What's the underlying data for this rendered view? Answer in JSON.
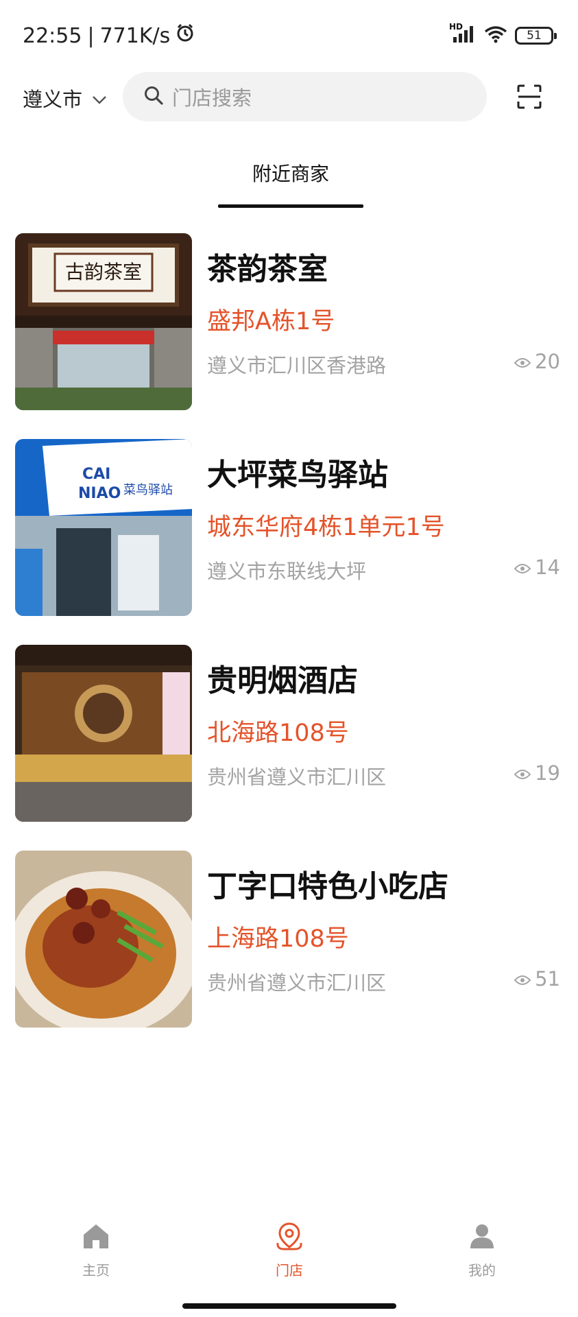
{
  "status_bar": {
    "time": "22:55",
    "speed": "771K/s",
    "battery": "51",
    "network": "HD"
  },
  "header": {
    "city": "遵义市",
    "search_placeholder": "门店搜索"
  },
  "tabs": [
    {
      "label": "附近商家",
      "active": true
    }
  ],
  "stores": [
    {
      "name": "茶韵茶室",
      "address": "盛邦A栋1号",
      "region": "遵义市汇川区香港路",
      "views": "20"
    },
    {
      "name": "大坪菜鸟驿站",
      "address": "城东华府4栋1单元1号",
      "region": "遵义市东联线大坪",
      "views": "14"
    },
    {
      "name": "贵明烟酒店",
      "address": "北海路108号",
      "region": "贵州省遵义市汇川区",
      "views": "19"
    },
    {
      "name": "丁字口特色小吃店",
      "address": "上海路108号",
      "region": "贵州省遵义市汇川区",
      "views": "51"
    }
  ],
  "bottom_nav": [
    {
      "label": "主页",
      "icon": "home-icon",
      "active": false
    },
    {
      "label": "门店",
      "icon": "store-location-icon",
      "active": true
    },
    {
      "label": "我的",
      "icon": "profile-icon",
      "active": false
    }
  ],
  "colors": {
    "accent": "#e4532a",
    "muted": "#a3a3a3",
    "search_bg": "#f2f2f2"
  }
}
